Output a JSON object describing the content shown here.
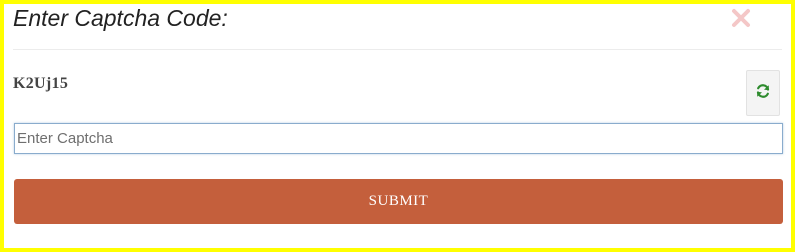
{
  "dialog": {
    "title": "Enter Captcha Code:",
    "close_icon": "close-icon",
    "captcha_code": "K2Uj15",
    "refresh_icon": "refresh-icon",
    "input": {
      "value": "",
      "placeholder": "Enter Captcha"
    },
    "submit_label": "SUBMIT"
  },
  "colors": {
    "frame": "#ffff00",
    "submit": "#c45f3c",
    "refresh_icon": "#2e8b2e",
    "close_icon": "#f4c7c7",
    "input_border": "#8aaccd"
  }
}
